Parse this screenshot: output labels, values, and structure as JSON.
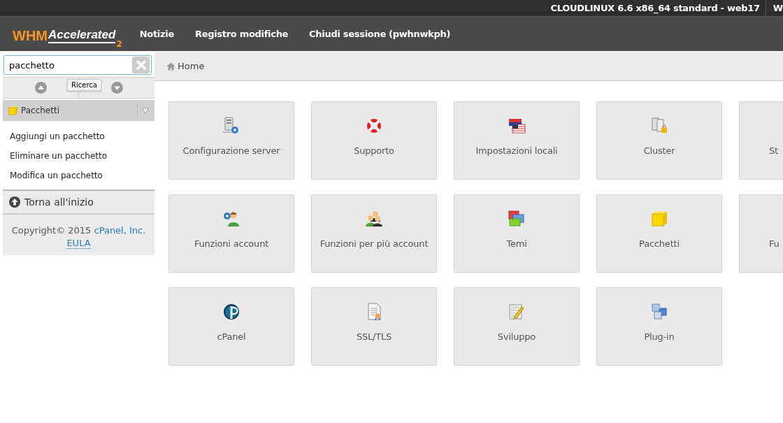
{
  "top_bar": {
    "system_info": "CLOUDLINUX 6.6 x86_64 standard - web17",
    "cut_item": "W"
  },
  "header": {
    "logo": {
      "brand": "WHM",
      "product": "Accelerated",
      "version": "2"
    },
    "nav": [
      "Notizie",
      "Registro modifiche",
      "Chiudi sessione (pwhnwkph)"
    ]
  },
  "sidebar": {
    "search": {
      "value": "pacchetto",
      "tooltip": "Ricerca"
    },
    "category": {
      "label": "Pacchetti",
      "expanded": true,
      "items": [
        "Aggiungi un pacchetto",
        "Eliminare un pacchetto",
        "Modifica un pacchetto"
      ]
    },
    "back_to_top": "Torna all'inizio",
    "footer": {
      "copyright": "Copyright© 2015 ",
      "company_link": "cPanel, Inc.",
      "eula_link": "EULA"
    }
  },
  "breadcrumb": [
    "Home"
  ],
  "tiles": [
    {
      "label": "Configurazione server",
      "kind": "full"
    },
    {
      "label": "Supporto",
      "kind": "full"
    },
    {
      "label": "Impostazioni locali",
      "kind": "full"
    },
    {
      "label": "Cluster",
      "kind": "full"
    },
    {
      "label": "St",
      "kind": "cut"
    },
    {
      "label": "Funzioni account",
      "kind": "full"
    },
    {
      "label": "Funzioni per più account",
      "kind": "full"
    },
    {
      "label": "Temi",
      "kind": "full"
    },
    {
      "label": "Pacchetti",
      "kind": "full"
    },
    {
      "label": "Fu",
      "kind": "cut"
    },
    {
      "label": "cPanel",
      "kind": "full"
    },
    {
      "label": "SSL/TLS",
      "kind": "full"
    },
    {
      "label": "Sviluppo",
      "kind": "full"
    },
    {
      "label": "Plug-in",
      "kind": "full"
    }
  ]
}
